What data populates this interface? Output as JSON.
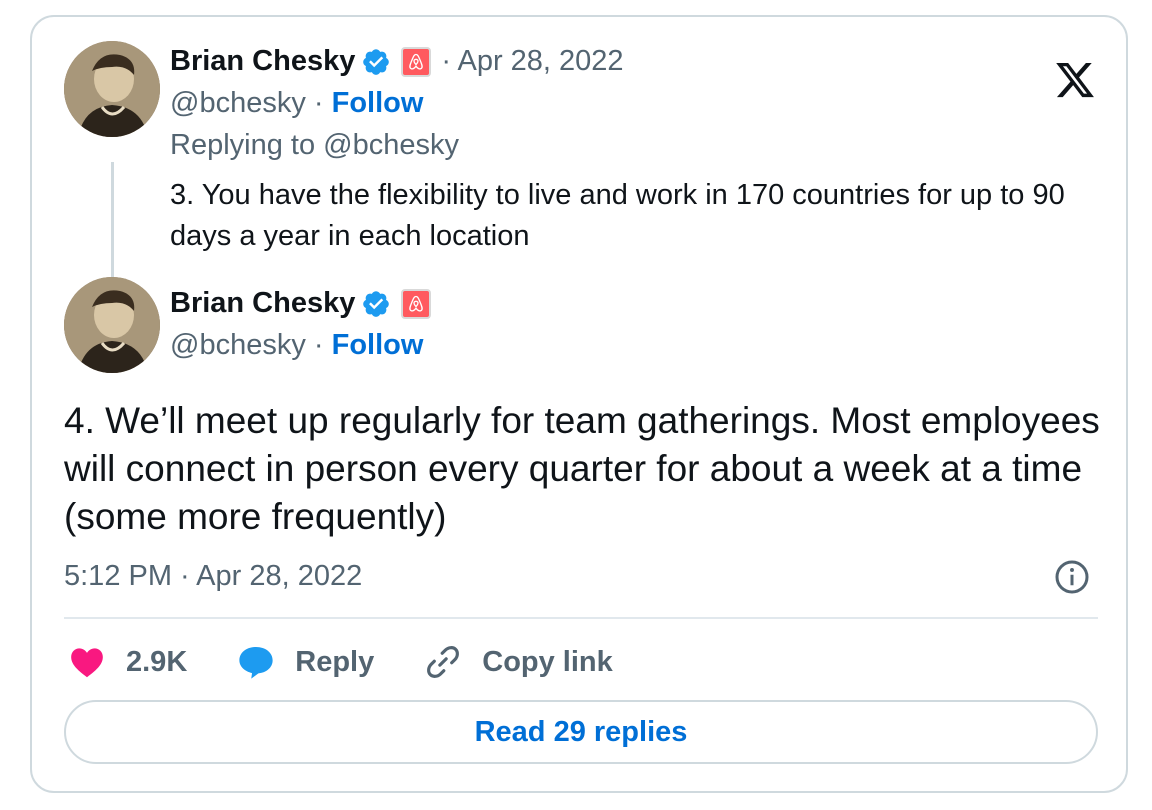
{
  "colors": {
    "link_blue": "#006fd6",
    "heart_pink": "#f91880",
    "reply_blue": "#1d9bf0",
    "muted_gray": "#536471",
    "airbnb_red": "#ff5a5f"
  },
  "icons": {
    "verified": "verified-badge-icon",
    "affiliation": "airbnb-logo-icon",
    "brand": "x-logo-icon",
    "info": "info-icon",
    "like": "heart-icon",
    "reply": "speech-bubble-icon",
    "copy": "link-icon"
  },
  "reply_tweet": {
    "author_name": "Brian Chesky",
    "date": "· Apr 28, 2022",
    "handle": "@bchesky",
    "separator": " · ",
    "follow_label": "Follow",
    "replying_to": "Replying to @bchesky",
    "text": "3. You have the flexibility to live and work in 170 countries for up to 90 days a year in each location"
  },
  "main_tweet": {
    "author_name": "Brian Chesky",
    "handle": "@bchesky",
    "separator": " · ",
    "follow_label": "Follow",
    "text": "4. We’ll meet up regularly for team gatherings. Most employees will connect in person every quarter for about a week at a time (some more frequently)",
    "timestamp": "5:12 PM · Apr 28, 2022"
  },
  "actions": {
    "like_count": "2.9K",
    "reply_label": "Reply",
    "copy_link_label": "Copy link"
  },
  "read_replies_label": "Read 29 replies"
}
